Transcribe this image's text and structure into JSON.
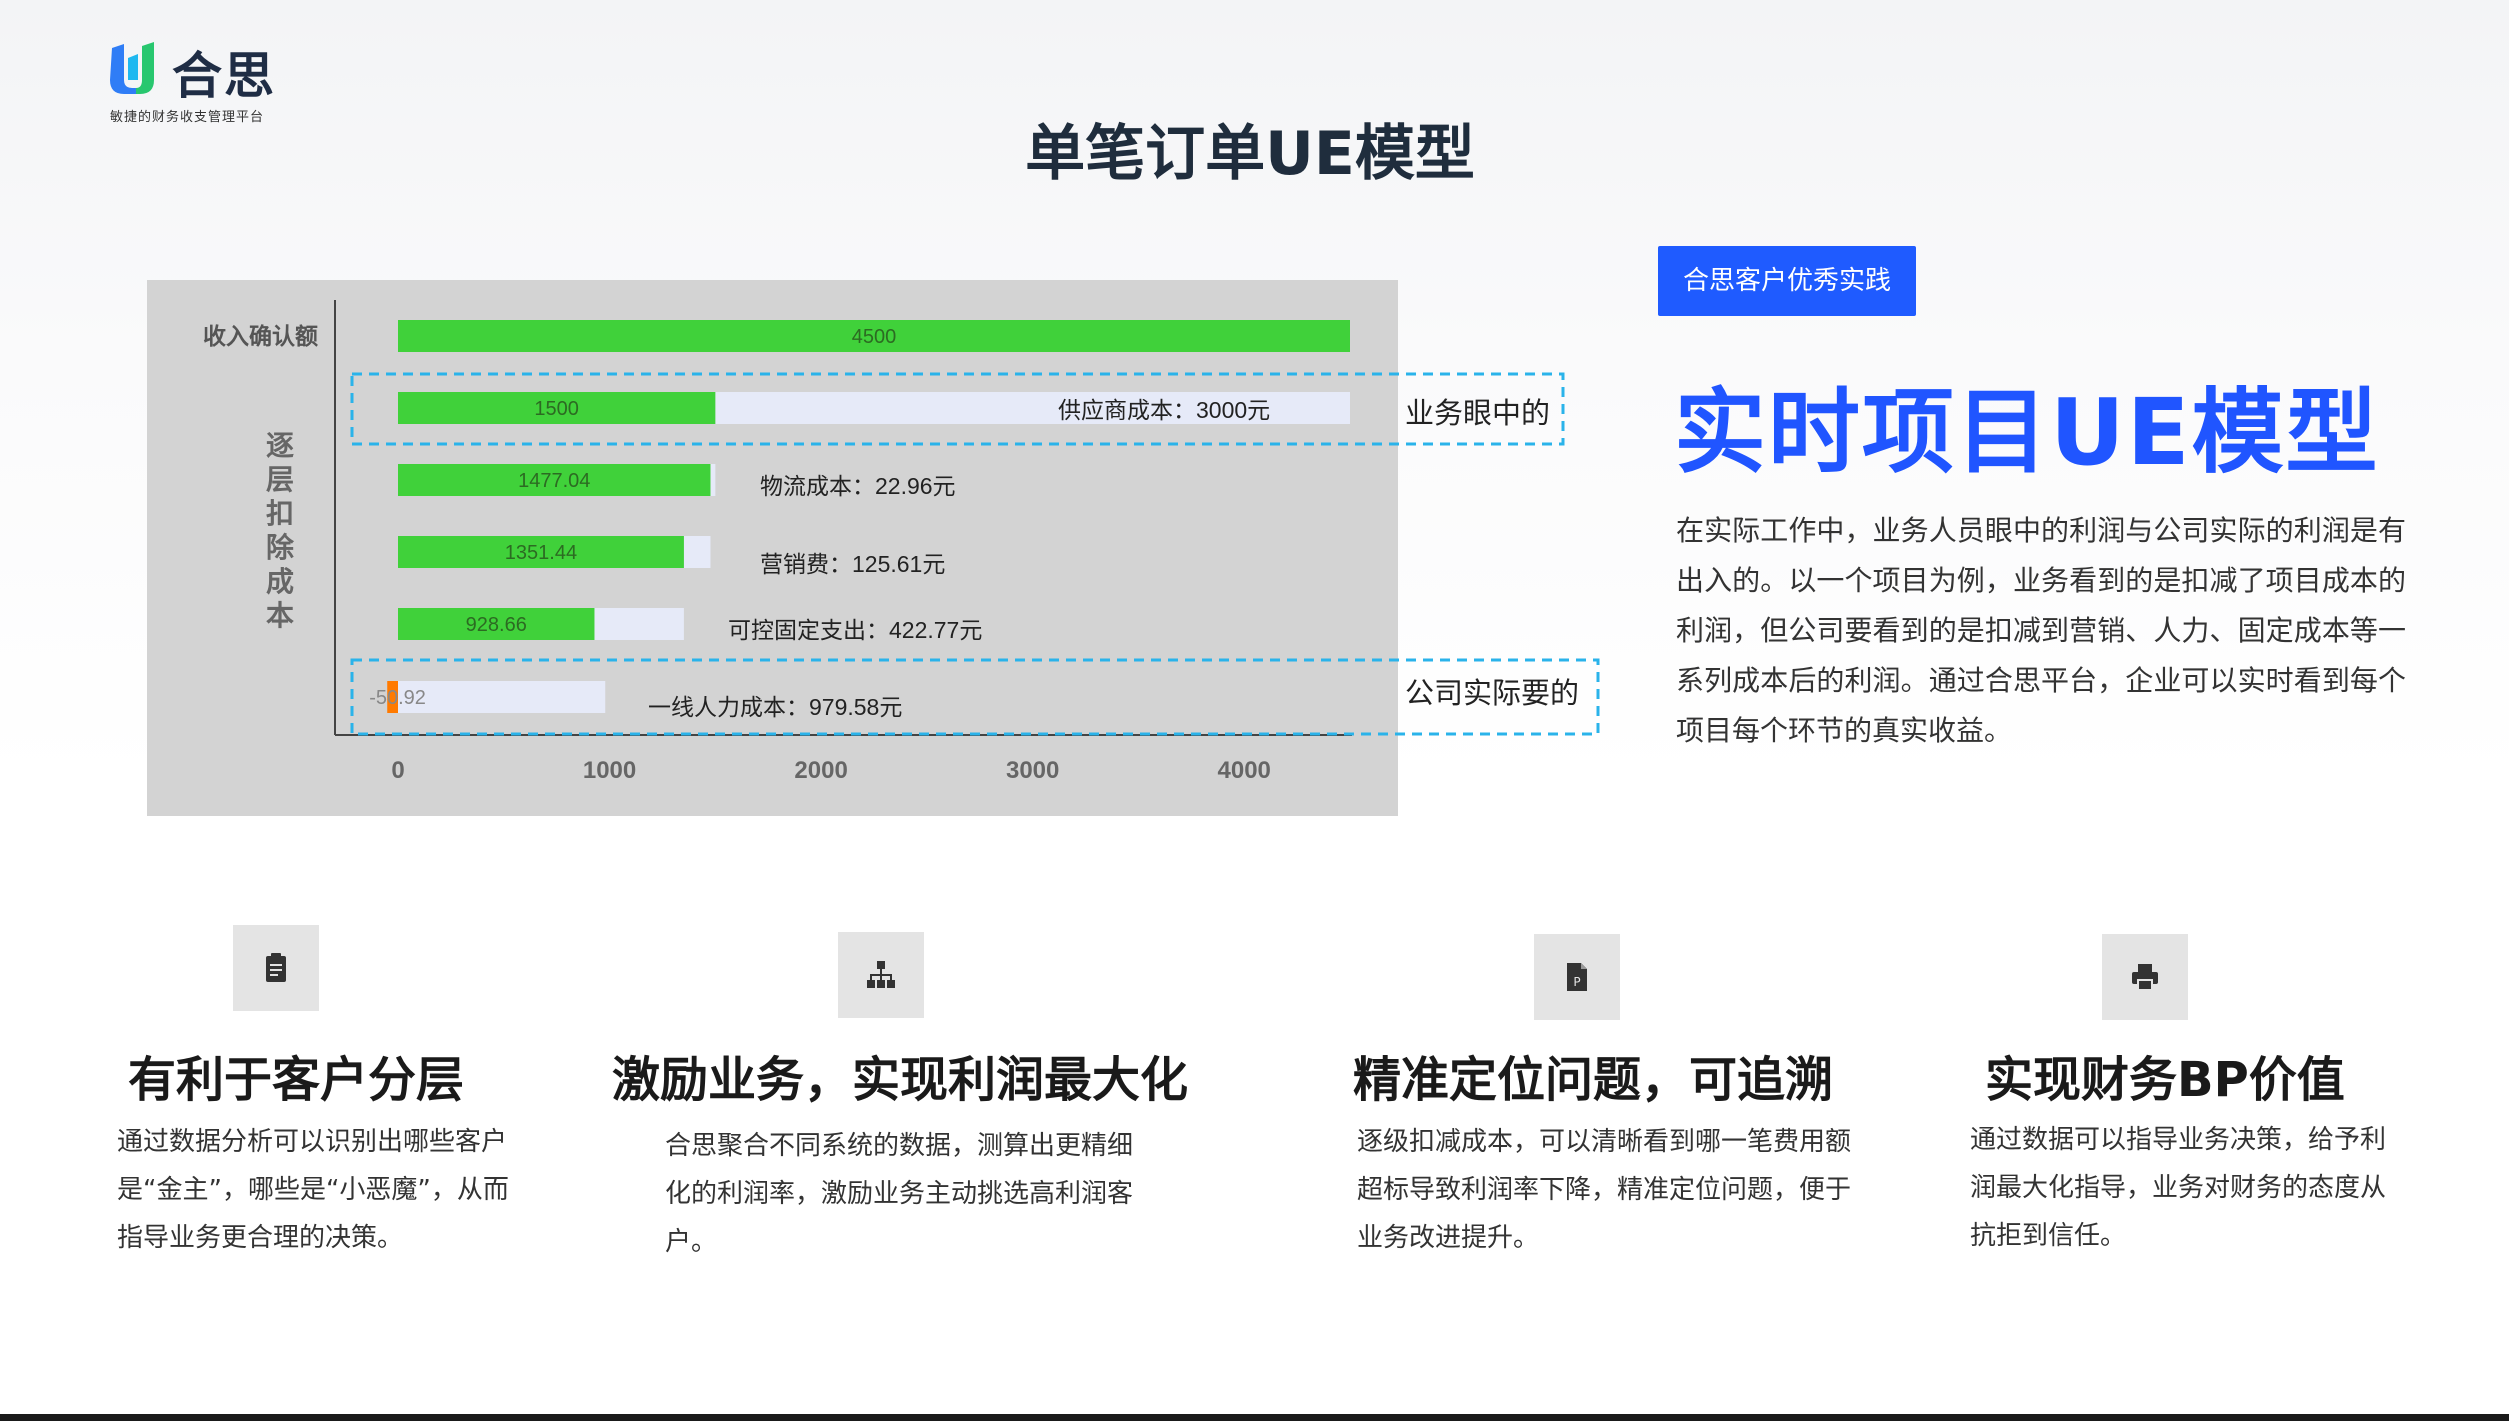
{
  "logo": {
    "name": "合思",
    "tagline": "敏捷的财务收支管理平台"
  },
  "page_title": "单笔订单UE模型",
  "chart_data": {
    "type": "bar",
    "orientation": "horizontal",
    "categories": [
      "收入确认额",
      "",
      "",
      "",
      "",
      ""
    ],
    "y_group_label": "逐层扣除成本",
    "values": [
      4500,
      1500,
      1477.04,
      1351.44,
      928.66,
      -50.92
    ],
    "value_labels": [
      "4500",
      "1500",
      "1477.04",
      "1351.44",
      "928.66",
      "-50.92"
    ],
    "deductions": [
      0,
      3000,
      22.96,
      125.61,
      422.77,
      979.58
    ],
    "deduction_labels": [
      "",
      "供应商成本：3000元",
      "物流成本：22.96元",
      "营销费：125.61元",
      "可控固定支出：422.77元",
      "一线人力成本：979.58元"
    ],
    "xlim": [
      0,
      4500
    ],
    "xticks": [
      "0",
      "1000",
      "2000",
      "3000",
      "4000"
    ],
    "highlight_boxes": [
      "业务眼中的",
      "公司实际要的"
    ],
    "colors": {
      "positive": "#40d13a",
      "negative": "#ff7a00",
      "deduction": "#e6eaf8",
      "panel": "#d3d3d3",
      "highlight": "#2ab3ea"
    }
  },
  "right_panel": {
    "badge": "合思客户优秀实践",
    "title": "实时项目UE模型",
    "description": "在实际工作中，业务人员眼中的利润与公司实际的利润是有出入的。以一个项目为例，业务看到的是扣减了项目成本的利润，但公司要看到的是扣减到营销、人力、固定成本等一系列成本后的利润。通过合思平台，企业可以实时看到每个项目每个环节的真实收益。"
  },
  "features": [
    {
      "icon": "clipboard-icon",
      "title": "有利于客户分层",
      "text": "通过数据分析可以识别出哪些客户是“金主”，哪些是“小恶魔”，从而指导业务更合理的决策。"
    },
    {
      "icon": "sitemap-icon",
      "title": "激励业务，实现利润最大化",
      "text": "合思聚合不同系统的数据，测算出更精细化的利润率，激励业务主动挑选高利润客户。"
    },
    {
      "icon": "document-p-icon",
      "title": "精准定位问题，可追溯",
      "text": "逐级扣减成本，可以清晰看到哪一笔费用额超标导致利润率下降，精准定位问题，便于业务改进提升。"
    },
    {
      "icon": "printer-icon",
      "title": "实现财务BP价值",
      "text": "通过数据可以指导业务决策，给予利润最大化指导，业务对财务的态度从抗拒到信任。"
    }
  ]
}
